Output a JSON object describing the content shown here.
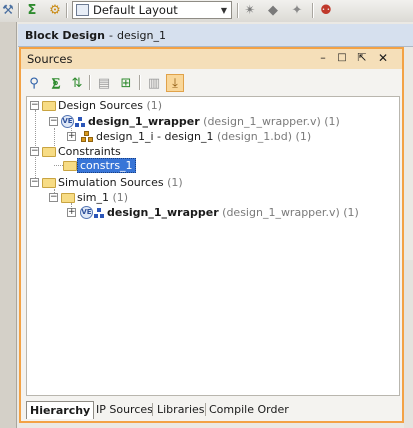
{
  "toolbar": {
    "layout_value": "Default Layout",
    "icons": [
      "wrench-icon",
      "sigma-icon",
      "gear-icon",
      "layout-icon",
      "pin-icon",
      "diamond-icon",
      "route-icon",
      "debug-icon"
    ]
  },
  "block_design": {
    "title": "Block Design",
    "separator": "-",
    "design_name": "design_1"
  },
  "panel": {
    "title": "Sources",
    "controls": [
      "minimize",
      "restore",
      "float",
      "close"
    ]
  },
  "tree": {
    "design_sources": {
      "label": "Design Sources",
      "count": "(1)"
    },
    "design_wrapper": {
      "name": "design_1_wrapper",
      "file": "(design_1_wrapper.v)",
      "count": "(1)"
    },
    "design_i": {
      "name": "design_1_i - design_1",
      "file": "(design_1.bd)",
      "count": "(1)"
    },
    "constraints": {
      "label": "Constraints"
    },
    "constrs": {
      "label": "constrs_1"
    },
    "sim_sources": {
      "label": "Simulation Sources",
      "count": "(1)"
    },
    "sim_1": {
      "label": "sim_1",
      "count": "(1)"
    },
    "sim_wrapper": {
      "name": "design_1_wrapper",
      "file": "(design_1_wrapper.v)",
      "count": "(1)"
    }
  },
  "tabs": {
    "hierarchy": "Hierarchy",
    "ip_sources": "IP Sources",
    "libraries": "Libraries",
    "compile_order": "Compile Order"
  },
  "colors": {
    "panel_border": "#f3a245",
    "panel_title_bg": "#f5dfb9",
    "selection": "#3875d7",
    "header_bg": "#d6e0ee"
  }
}
